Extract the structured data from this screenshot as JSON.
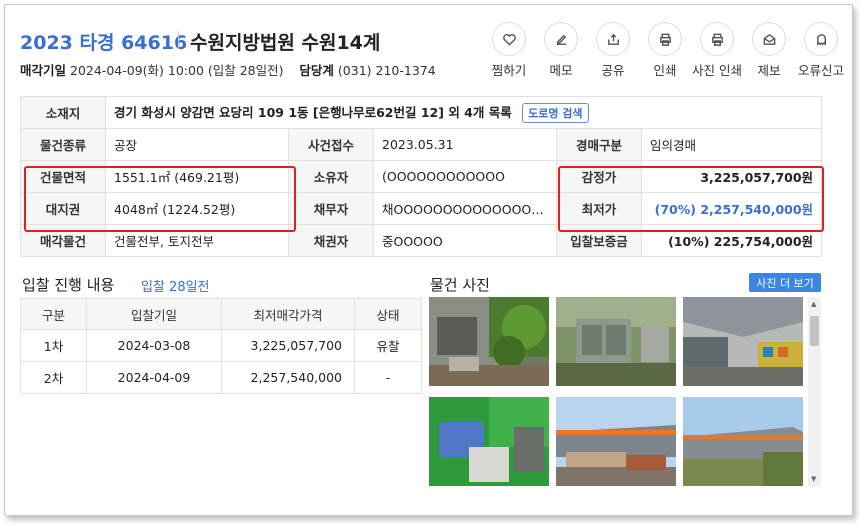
{
  "header": {
    "case_no": "2023 타경 64616",
    "court": "수원지방법원 수원14계",
    "sale_date_label": "매각기일",
    "sale_date_value": "2024-04-09(화) 10:00 (입찰 28일전)",
    "contact_label": "담당계",
    "contact_value": "(031) 210-1374"
  },
  "actions": [
    {
      "label": "찜하기",
      "icon": "heart-icon"
    },
    {
      "label": "메모",
      "icon": "edit-icon"
    },
    {
      "label": "공유",
      "icon": "share-icon"
    },
    {
      "label": "인쇄",
      "icon": "print-icon"
    },
    {
      "label": "사진 인쇄",
      "icon": "print-icon"
    },
    {
      "label": "제보",
      "icon": "mail-icon"
    },
    {
      "label": "오류신고",
      "icon": "ghost-icon"
    }
  ],
  "info": {
    "location_label": "소재지",
    "location_value": "경기 화성시 양감면 요당리 109 1동 [은행나무로62번길 12] 외 4개 목록",
    "road_btn": "도로명 검색",
    "type_label": "물건종류",
    "type_value": "공장",
    "received_label": "사건접수",
    "received_value": "2023.05.31",
    "auction_kind_label": "경매구분",
    "auction_kind_value": "임의경매",
    "building_area_label": "건물면적",
    "building_area_value": "1551.1㎡ (469.21평)",
    "owner_label": "소유자",
    "owner_value": "(OOOOOOOOOOOO",
    "appraisal_label": "감정가",
    "appraisal_value": "3,225,057,700원",
    "land_label": "대지권",
    "land_value": "4048㎡ (1224.52평)",
    "debtor_label": "채무자",
    "debtor_value": "채OOOOOOOOOOOOOOOOO",
    "min_price_label": "최저가",
    "min_price_value": "(70%) 2,257,540,000원",
    "sale_item_label": "매각물건",
    "sale_item_value": "건물전부, 토지전부",
    "creditor_label": "채권자",
    "creditor_value": "중OOOOO",
    "deposit_label": "입찰보증금",
    "deposit_value": "(10%) 225,754,000원"
  },
  "bids": {
    "title": "입찰 진행 내용",
    "subtitle": "입찰 28일전",
    "headers": [
      "구분",
      "입찰기일",
      "최저매각가격",
      "상태"
    ],
    "rows": [
      [
        "1차",
        "2024-03-08",
        "3,225,057,700",
        "유찰"
      ],
      [
        "2차",
        "2024-04-09",
        "2,257,540,000",
        "-"
      ]
    ]
  },
  "photos": {
    "title": "물건 사진",
    "more_btn": "사진 더 보기"
  },
  "colors": {
    "accent": "#3a6fd0",
    "highlight_box": "#e21f1f",
    "button_blue": "#3a86e0"
  }
}
